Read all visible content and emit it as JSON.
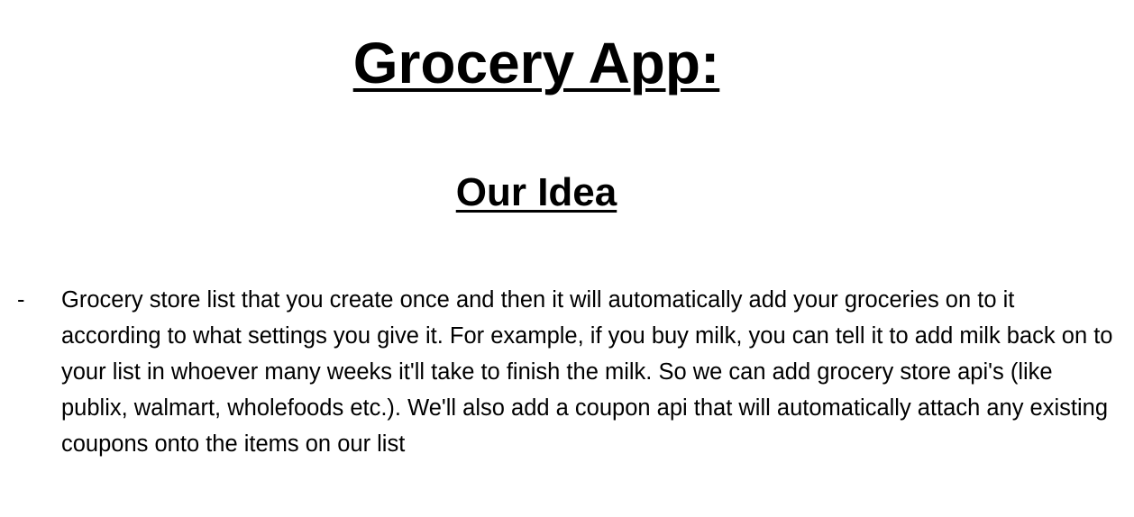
{
  "document": {
    "title": "Grocery App:",
    "section_heading": "Our Idea",
    "bullets": [
      {
        "marker": "-",
        "text": "Grocery store list that you create once and then it will automatically add your groceries on to it according to what settings you give it. For example, if you buy milk, you can tell it to add milk back on to your list in whoever many weeks it'll take to finish the milk. So we can add grocery store api's (like publix, walmart, wholefoods etc.). We'll also add a coupon api that will automatically attach any existing coupons onto the items on our list"
      }
    ]
  }
}
